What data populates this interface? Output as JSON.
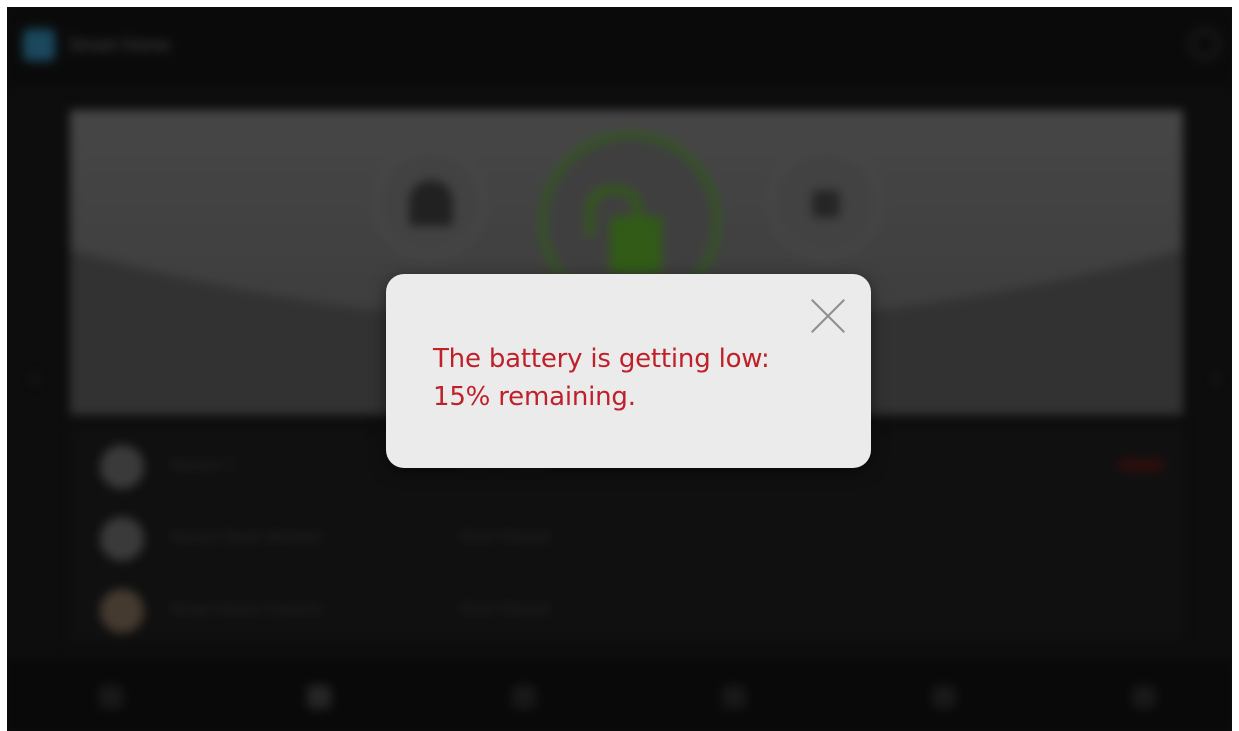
{
  "app": {
    "title": "Smart Home"
  },
  "modes": {
    "home_icon": "home-icon",
    "disarm_icon": "unlock-icon",
    "away_icon": "lock-icon"
  },
  "devices": [
    {
      "name": "Sensor 1",
      "status": "Door Closed",
      "icon": "sensor-icon"
    },
    {
      "name": "Sensor Back Window",
      "status": "Door Closed",
      "icon": "sensor-icon"
    },
    {
      "name": "Smart Home Camera",
      "status": "Door Closed",
      "icon": "camera-icon"
    }
  ],
  "dialog": {
    "message": "The battery is getting low: 15% remaining.",
    "message_color": "#c0202a",
    "close_icon": "close-icon"
  },
  "colors": {
    "accent_green": "#4c8c24",
    "alert_red": "#c0202a"
  }
}
